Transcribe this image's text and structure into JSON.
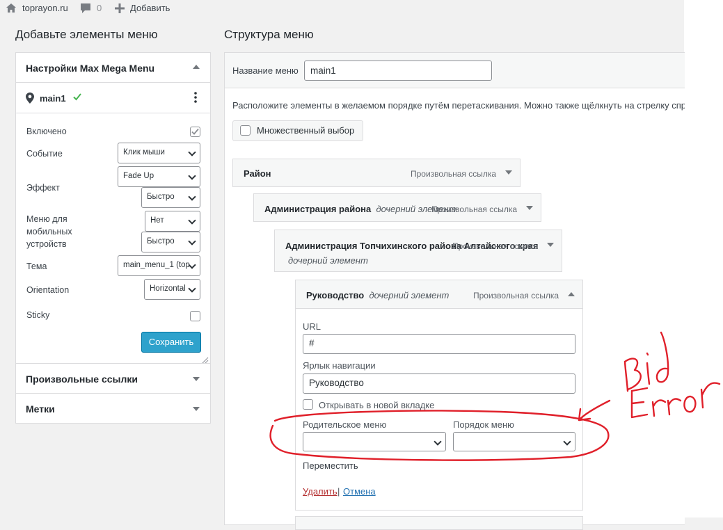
{
  "adminbar": {
    "site_name": "toprayon.ru",
    "comments_count": "0",
    "add_label": "Добавить"
  },
  "left": {
    "heading": "Добавьте элементы меню",
    "mega_menu_title": "Настройки Max Mega Menu",
    "location_name": "main1",
    "settings": {
      "enabled_label": "Включено",
      "event_label": "Событие",
      "event_value": "Клик мыши",
      "effect_label": "Эффект",
      "effect_value": "Fade Up",
      "effect_speed_value": "Быстро",
      "mobile_label": "Меню для мобильных устройств",
      "mobile_value": "Нет",
      "mobile_speed_value": "Быстро",
      "theme_label": "Тема",
      "theme_value": "main_menu_1 (top",
      "orientation_label": "Orientation",
      "orientation_value": "Horizontal",
      "sticky_label": "Sticky",
      "save_label": "Сохранить"
    },
    "custom_links_title": "Произвольные ссылки",
    "tags_title": "Метки"
  },
  "right": {
    "heading": "Структура меню",
    "menu_name_label": "Название меню",
    "menu_name_value": "main1",
    "instructions": "Расположите элементы в желаемом порядке путём перетаскивания. Можно также щёлкнуть на стрелку спра",
    "bulk_select_label": "Множественный выбор",
    "items": [
      {
        "title": "Район",
        "sub": "",
        "type": "Произвольная ссылка"
      },
      {
        "title": "Администрация района",
        "sub": "дочерний элемент",
        "type": "Произвольная ссылка"
      },
      {
        "title": "Администрация Топчихинского района Алтайского края",
        "sub": "дочерний элемент",
        "type": "Произвольная ссылка"
      },
      {
        "title": "Руководство",
        "sub": "дочерний элемент",
        "type": "Произвольная ссылка"
      }
    ],
    "edit": {
      "url_label": "URL",
      "url_value": "#",
      "nav_label_label": "Ярлык навигации",
      "nav_label_value": "Руководство",
      "new_tab_label": "Открывать в новой вкладке",
      "parent_label": "Родительское меню",
      "order_label": "Порядок меню",
      "move_label": "Переместить",
      "delete_label": "Удалить",
      "separator": "|",
      "cancel_label": "Отмена"
    }
  },
  "colors": {
    "annotation": "#e0202a",
    "link": "#2271b1",
    "delete": "#b32d2e",
    "save_button": "#2ea2cc",
    "check": "#46b450"
  }
}
